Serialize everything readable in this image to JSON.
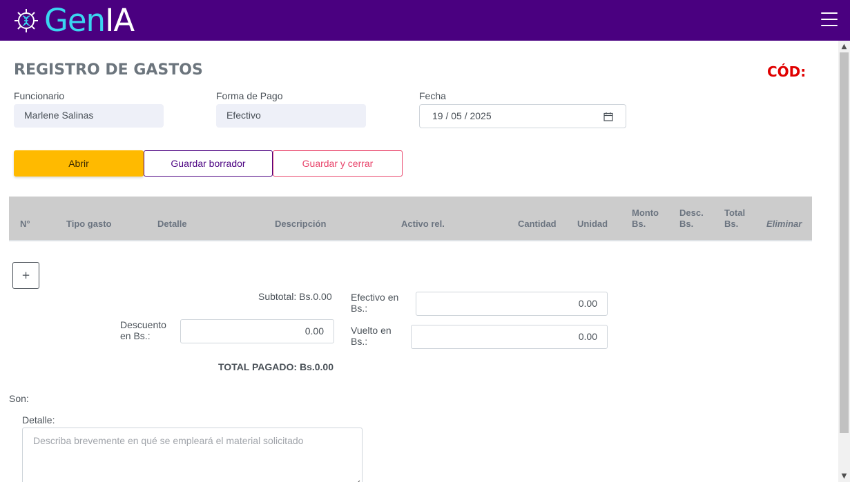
{
  "app": {
    "logo_gen": "Gen",
    "logo_ia": "IA"
  },
  "page": {
    "title": "REGISTRO DE GASTOS",
    "code_label": "CÓD:"
  },
  "form": {
    "funcionario_label": "Funcionario",
    "funcionario_value": "Marlene Salinas",
    "forma_pago_label": "Forma de Pago",
    "forma_pago_value": "Efectivo",
    "fecha_label": "Fecha",
    "fecha_value": "19 / 05 / 2025"
  },
  "actions": {
    "abrir": "Abrir",
    "guardar_borrador": "Guardar borrador",
    "guardar_cerrar": "Guardar y cerrar"
  },
  "table": {
    "columns": {
      "numero": "N°",
      "tipo_gasto": "Tipo gasto",
      "detalle": "Detalle",
      "descripcion": "Descripción",
      "activo_rel": "Activo rel.",
      "cantidad": "Cantidad",
      "unidad": "Unidad",
      "monto_1": "Monto",
      "monto_2": "Bs.",
      "desc_1": "Desc.",
      "desc_2": "Bs.",
      "total_1": "Total",
      "total_2": "Bs.",
      "eliminar": "Eliminar"
    },
    "add_label": "+"
  },
  "summary": {
    "subtotal": "Subtotal: Bs.0.00",
    "descuento_label_1": "Descuento",
    "descuento_label_2": "en Bs.:",
    "descuento_value": "0.00",
    "efectivo_label_1": "Efectivo en",
    "efectivo_label_2": "Bs.:",
    "efectivo_value": "0.00",
    "vuelto_label_1": "Vuelto en",
    "vuelto_label_2": "Bs.:",
    "vuelto_value": "0.00",
    "total_pagado": "TOTAL PAGADO: Bs.0.00"
  },
  "footer": {
    "son_label": "Son:",
    "detalle_label": "Detalle:",
    "detalle_placeholder": "Describa brevemente en qué se empleará el material solicitado"
  },
  "colors": {
    "navbar": "#4a0080",
    "logo_cyan": "#3ad6f0",
    "abrir": "#ffba00",
    "borrador_border": "#4a0080",
    "cerrar_border": "#e8436a",
    "cod": "#e00000",
    "table_header": "#cccccc"
  }
}
